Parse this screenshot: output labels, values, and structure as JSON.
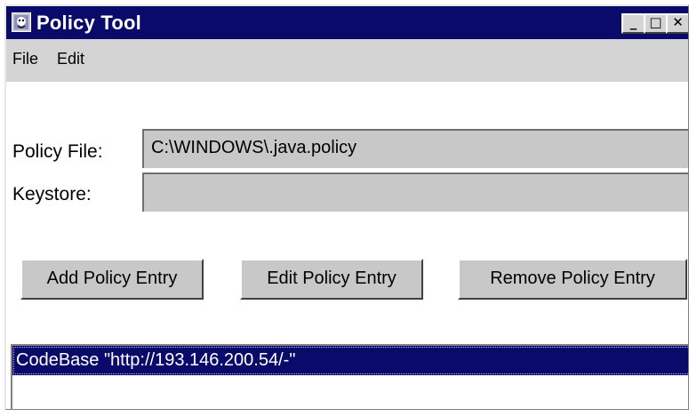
{
  "window": {
    "title": "Policy Tool",
    "controls": {
      "minimize": "_",
      "maximize": "□",
      "close": "✕"
    }
  },
  "menu": {
    "file": "File",
    "edit": "Edit"
  },
  "fields": {
    "policy_file_label": "Policy File:",
    "policy_file_value": "C:\\WINDOWS\\.java.policy",
    "keystore_label": "Keystore:",
    "keystore_value": ""
  },
  "buttons": {
    "add": "Add Policy Entry",
    "edit": "Edit Policy Entry",
    "remove": "Remove Policy Entry"
  },
  "entries": [
    {
      "label": "CodeBase \"http://193.146.200.54/-\"",
      "selected": true
    }
  ],
  "colors": {
    "titlebar": "#0a0a6b",
    "selection": "#0a0a6b",
    "window_bg": "#c8c8c8"
  }
}
